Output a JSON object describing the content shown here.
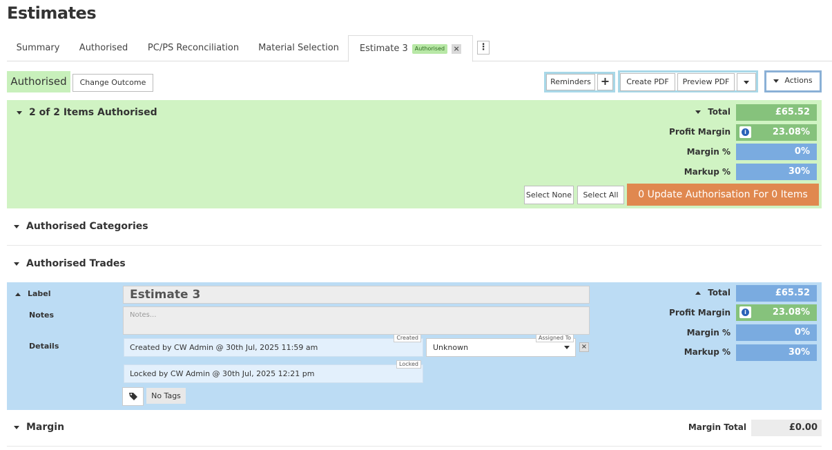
{
  "page": {
    "title": "Estimates"
  },
  "tabs": [
    {
      "label": "Summary"
    },
    {
      "label": "Authorised"
    },
    {
      "label": "PC/PS Reconciliation"
    },
    {
      "label": "Material Selection"
    },
    {
      "label": "Estimate 3",
      "badge": "Authorised",
      "close": "×",
      "active": true
    }
  ],
  "tab_menu": "⋮",
  "toolbar": {
    "status": "Authorised",
    "change_outcome": "Change Outcome",
    "reminders": "Reminders",
    "add": "+",
    "create_pdf": "Create PDF",
    "preview_pdf": "Preview PDF",
    "actions": "Actions"
  },
  "items_panel": {
    "heading": "2 of 2 Items Authorised",
    "total_label": "Total",
    "total_value": "£65.52",
    "profit_margin_label": "Profit Margin",
    "profit_margin_value": "23.08%",
    "margin_pct_label": "Margin %",
    "margin_pct_value": "0%",
    "markup_pct_label": "Markup %",
    "markup_pct_value": "30%",
    "select_none": "Select None",
    "select_all": "Select All",
    "update_button": "0 Update Authorisation For 0 Items",
    "colors": {
      "panel": "#d0f3c3",
      "accent": "#e0884f"
    }
  },
  "sections": {
    "categories": "Authorised Categories",
    "trades": "Authorised Trades"
  },
  "estimate": {
    "label_label": "Label",
    "label_value": "Estimate 3",
    "notes_label": "Notes",
    "notes_placeholder": "Notes...",
    "details_label": "Details",
    "created_text": "Created by CW Admin @ 30th Jul, 2025 11:59 am",
    "created_tag": "Created",
    "locked_text": "Locked by CW Admin @ 30th Jul, 2025 12:21 pm",
    "locked_tag": "Locked",
    "assigned_tag": "Assigned To",
    "assigned_value": "Unknown",
    "clear": "×",
    "no_tags": "No Tags",
    "total_label": "Total",
    "total_value": "£65.52",
    "profit_margin_label": "Profit Margin",
    "profit_margin_value": "23.08%",
    "margin_pct_label": "Margin %",
    "margin_pct_value": "0%",
    "markup_pct_label": "Markup %",
    "markup_pct_value": "30%",
    "colors": {
      "panel": "#bcdcf4"
    }
  },
  "margin": {
    "heading": "Margin",
    "total_label": "Margin Total",
    "total_value": "£0.00"
  },
  "icons": [
    "info-icon",
    "tag-icon",
    "chevron-down-icon",
    "chevron-up-icon",
    "close-icon",
    "kebab-menu-icon",
    "plus-icon"
  ]
}
